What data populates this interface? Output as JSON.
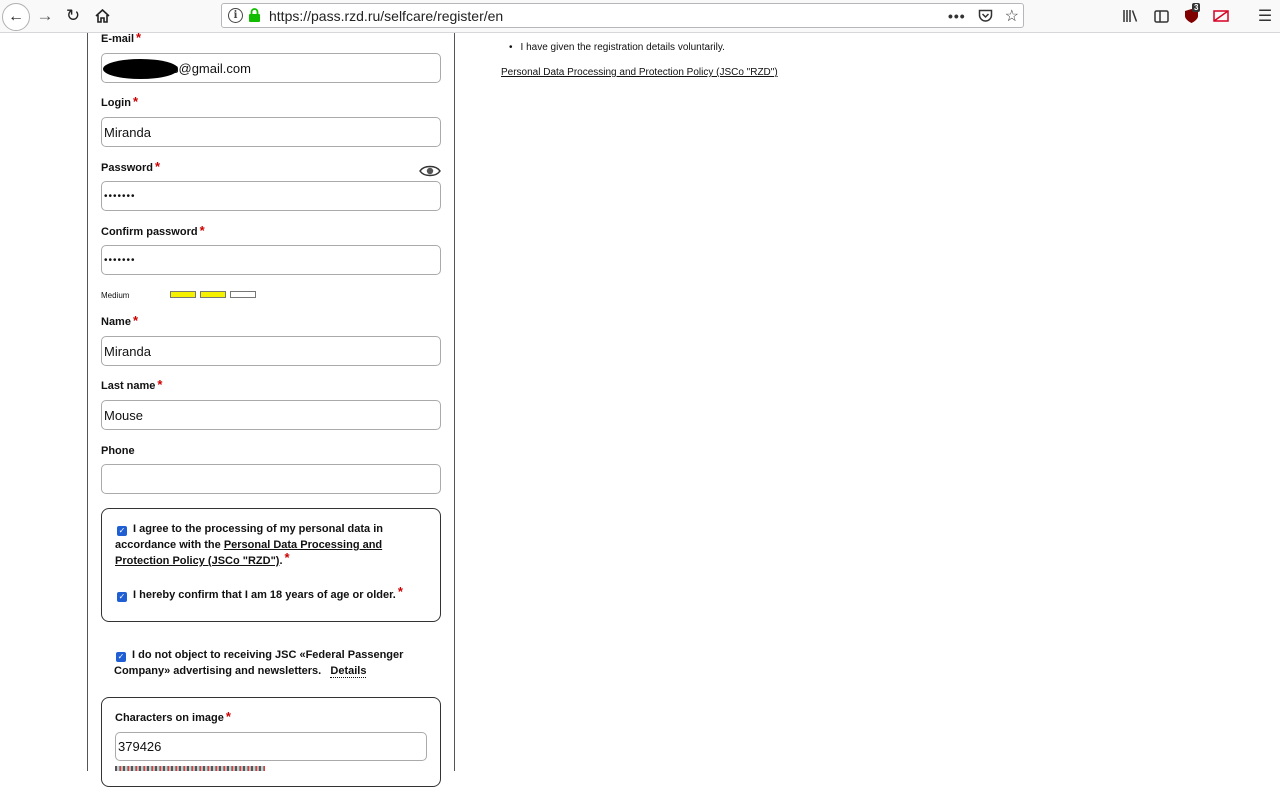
{
  "browser": {
    "url": "https://pass.rzd.ru/selfcare/register/en",
    "ublock_count": "3"
  },
  "form": {
    "email_label": "E-mail",
    "email_value": "s@gmail.com",
    "login_label": "Login",
    "login_value": "Miranda",
    "password_label": "Password",
    "password_value": "•••••••",
    "confirm_label": "Confirm password",
    "confirm_value": "•••••••",
    "strength_label": "Medium",
    "strength_level": 0.67,
    "strength_colors": [
      "#f5f100",
      "#f5f100",
      "#ffffff"
    ],
    "name_label": "Name",
    "name_value": "Miranda",
    "lastname_label": "Last name",
    "lastname_value": "Mouse",
    "phone_label": "Phone",
    "phone_value": "",
    "required_mark": "*"
  },
  "consent": {
    "agree_text_before": "I agree to the processing of my personal data in accordance with the ",
    "agree_link": "Personal Data Processing and Protection Policy (JSCo \"RZD\")",
    "agree_text_after": ".",
    "agree_checked": true,
    "age_text": "I hereby confirm that I am 18 years of age or older.",
    "age_checked": true,
    "newsletter_text": "I do not object to receiving JSC «Federal Passenger Company» advertising and newsletters.",
    "newsletter_details": "Details",
    "newsletter_checked": true
  },
  "captcha": {
    "label": "Characters on image",
    "value": "379426"
  },
  "right_panel": {
    "bullet": "I have given the registration details voluntarily.",
    "policy_link": "Personal Data Processing and Protection Policy (JSCo \"RZD\")"
  },
  "colors": {
    "checkbox": "#1f5ed3",
    "required": "#cc0000",
    "strength_fill": "#f5f100"
  }
}
